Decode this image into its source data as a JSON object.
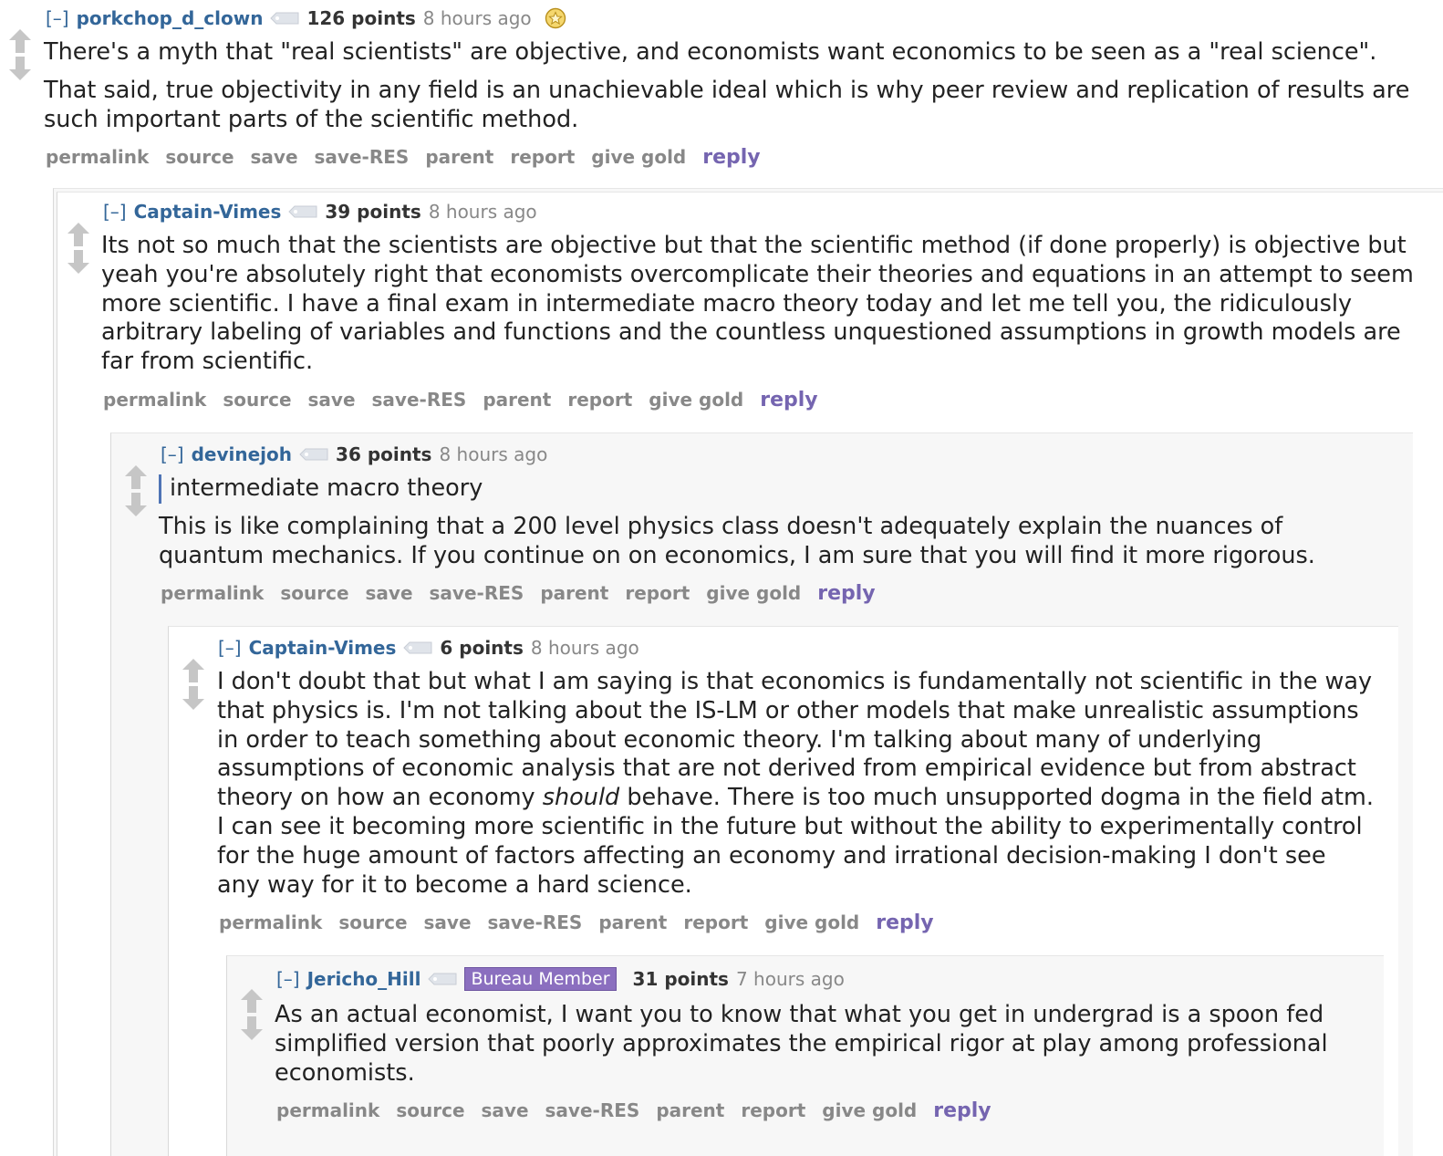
{
  "comments": [
    {
      "author": "porkchop_d_clown",
      "score": "126 points",
      "time": "8 hours ago",
      "paragraphs": [
        "There's a myth that \"real scientists\" are objective, and economists want economics to be seen as a \"real science\".",
        "That said, true objectivity in any field is an unachievable ideal which is why peer review and replication of results are such important parts of the scientific method."
      ]
    },
    {
      "author": "Captain-Vimes",
      "score": "39 points",
      "time": "8 hours ago",
      "paragraphs": [
        "Its not so much that the scientists are objective but that the scientific method (if done properly) is objective but yeah you're absolutely right that economists overcomplicate their theories and equations in an attempt to seem more scientific. I have a final exam in intermediate macro theory today and let me tell you, the ridiculously arbitrary labeling of variables and functions and the countless unquestioned assumptions in growth models are far from scientific."
      ]
    },
    {
      "author": "devinejoh",
      "score": "36 points",
      "time": "8 hours ago",
      "quote": "intermediate macro theory",
      "paragraphs": [
        "This is like complaining that a 200 level physics class doesn't adequately explain the nuances of quantum mechanics. If you continue on on economics, I am sure that you will find it more rigorous."
      ]
    },
    {
      "author": "Captain-Vimes",
      "score": "6 points",
      "time": "8 hours ago",
      "body_before_em": "I don't doubt that but what I am saying is that economics is fundamentally not scientific in the way that physics is. I'm not talking about the IS-LM or other models that make unrealistic assumptions in order to teach something about economic theory. I'm talking about many of underlying assumptions of economic analysis that are not derived from empirical evidence but from abstract theory on how an economy ",
      "body_em": "should",
      "body_after_em": " behave. There is too much unsupported dogma in the field atm. I can see it becoming more scientific in the future but without the ability to experimentally control for the huge amount of factors affecting an economy and irrational decision-making I don't see any way for it to become a hard science."
    },
    {
      "author": "Jericho_Hill",
      "flair": "Bureau Member",
      "score": "31 points",
      "time": "7 hours ago",
      "paragraphs": [
        "As an actual economist, I want you to know that what you get in undergrad is a spoon fed simplified version that poorly approximates the empirical rigor at play among professional economists."
      ]
    }
  ],
  "ui": {
    "expand": "[–]",
    "buttons": {
      "permalink": "permalink",
      "source": "source",
      "save": "save",
      "save_res": "save-RES",
      "parent": "parent",
      "report": "report",
      "give_gold": "give gold",
      "reply": "reply"
    }
  },
  "icons": {
    "upvote": "upvote-arrow-icon",
    "downvote": "downvote-arrow-icon",
    "res_tag": "res-user-tag-icon",
    "gold": "gilded-star-icon"
  },
  "colors": {
    "author": "#336699",
    "reply": "#7565b0",
    "flair_bg": "#8b6fbf",
    "muted": "#888888",
    "quote_bar": "#4f74b5",
    "child_grey": "#f7f7f7"
  }
}
